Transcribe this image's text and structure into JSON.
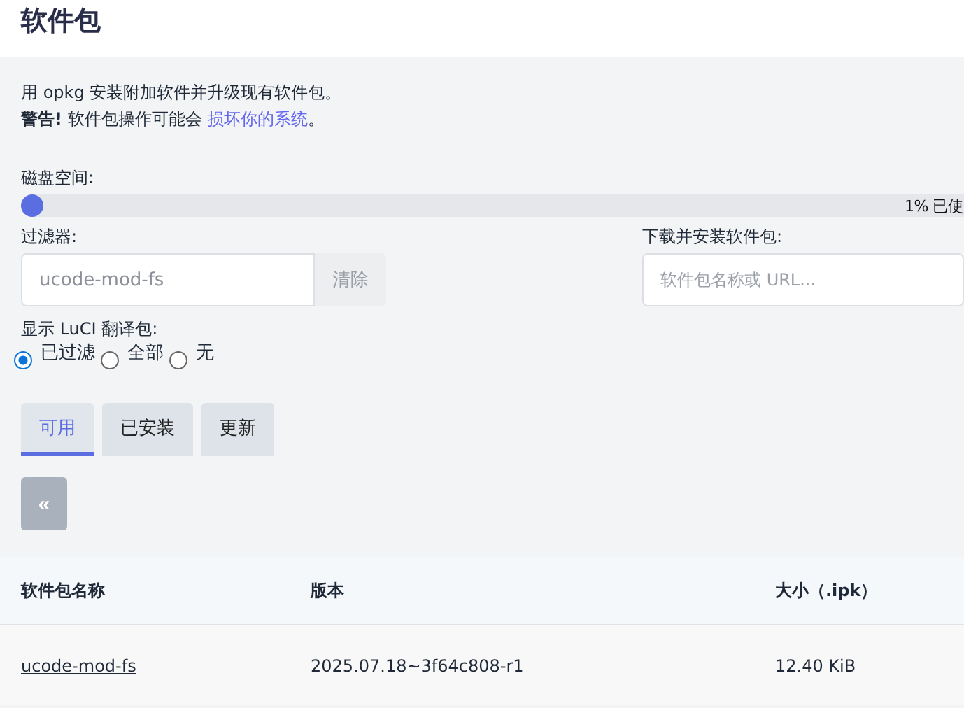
{
  "title": "软件包",
  "intro": "用 opkg 安装附加软件并升级现有软件包。",
  "warning": {
    "label": "警告!",
    "text": "软件包操作可能会",
    "link": "损坏你的系统",
    "end": "。"
  },
  "disk": {
    "label": "磁盘空间:",
    "level": 0.01,
    "reading": "1% 已使"
  },
  "filter": {
    "label": "过滤器:",
    "value": "ucode-mod-fs",
    "clear": "清除"
  },
  "download": {
    "label": "下载并安装软件包:",
    "placeholder": "软件包名称或 URL..."
  },
  "translations": {
    "label": "显示 LuCI 翻译包:",
    "options": [
      {
        "label": "已过滤",
        "selected": true
      },
      {
        "label": "全部",
        "selected": false
      },
      {
        "label": "无",
        "selected": false
      }
    ]
  },
  "tabs": [
    {
      "label": "可用",
      "selected": true
    },
    {
      "label": "已安装",
      "selected": false
    },
    {
      "label": "更新",
      "selected": false
    }
  ],
  "pager": {
    "prev": "«"
  },
  "table": {
    "columns": [
      "软件包名称",
      "版本",
      "大小（.ipk）"
    ],
    "rows": [
      {
        "name": "ucode-mod-fs",
        "version": "2025.07.18~3f64c808-r1",
        "size": "12.40 KiB"
      }
    ]
  }
}
